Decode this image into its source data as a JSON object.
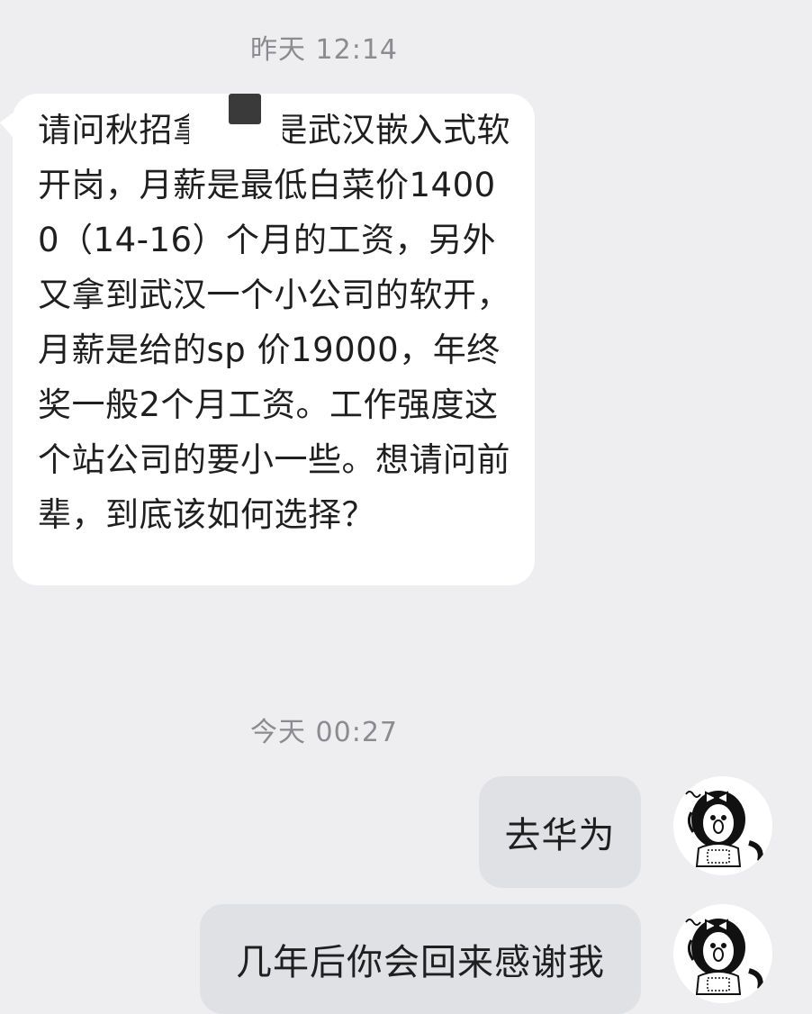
{
  "chat": {
    "timestamp_1": "昨天 12:14",
    "timestamp_2": "今天 00:27",
    "incoming_message": "请问秋招拿到的是武汉嵌入式软开岗，月薪是最低白菜价14000（14-16）个月的工资，另外又拿到武汉一个小公司的软开，月薪是给的sp 价19000，年终奖一般2个月工资。工作强度这个站公司的要小一些。想请问前辈，到底该如何选择？",
    "outgoing_message_1": "去华为",
    "outgoing_message_2": "几年后你会回来感谢我"
  },
  "avatars": {
    "self_avatar_icon": "cartoon-girl-with-bow-avatar"
  },
  "colors": {
    "background": "#eeeef0",
    "incoming_bubble": "#ffffff",
    "outgoing_bubble": "#dfe1e5",
    "timestamp_text": "#8c8c90",
    "message_text": "#1f1f1f"
  }
}
